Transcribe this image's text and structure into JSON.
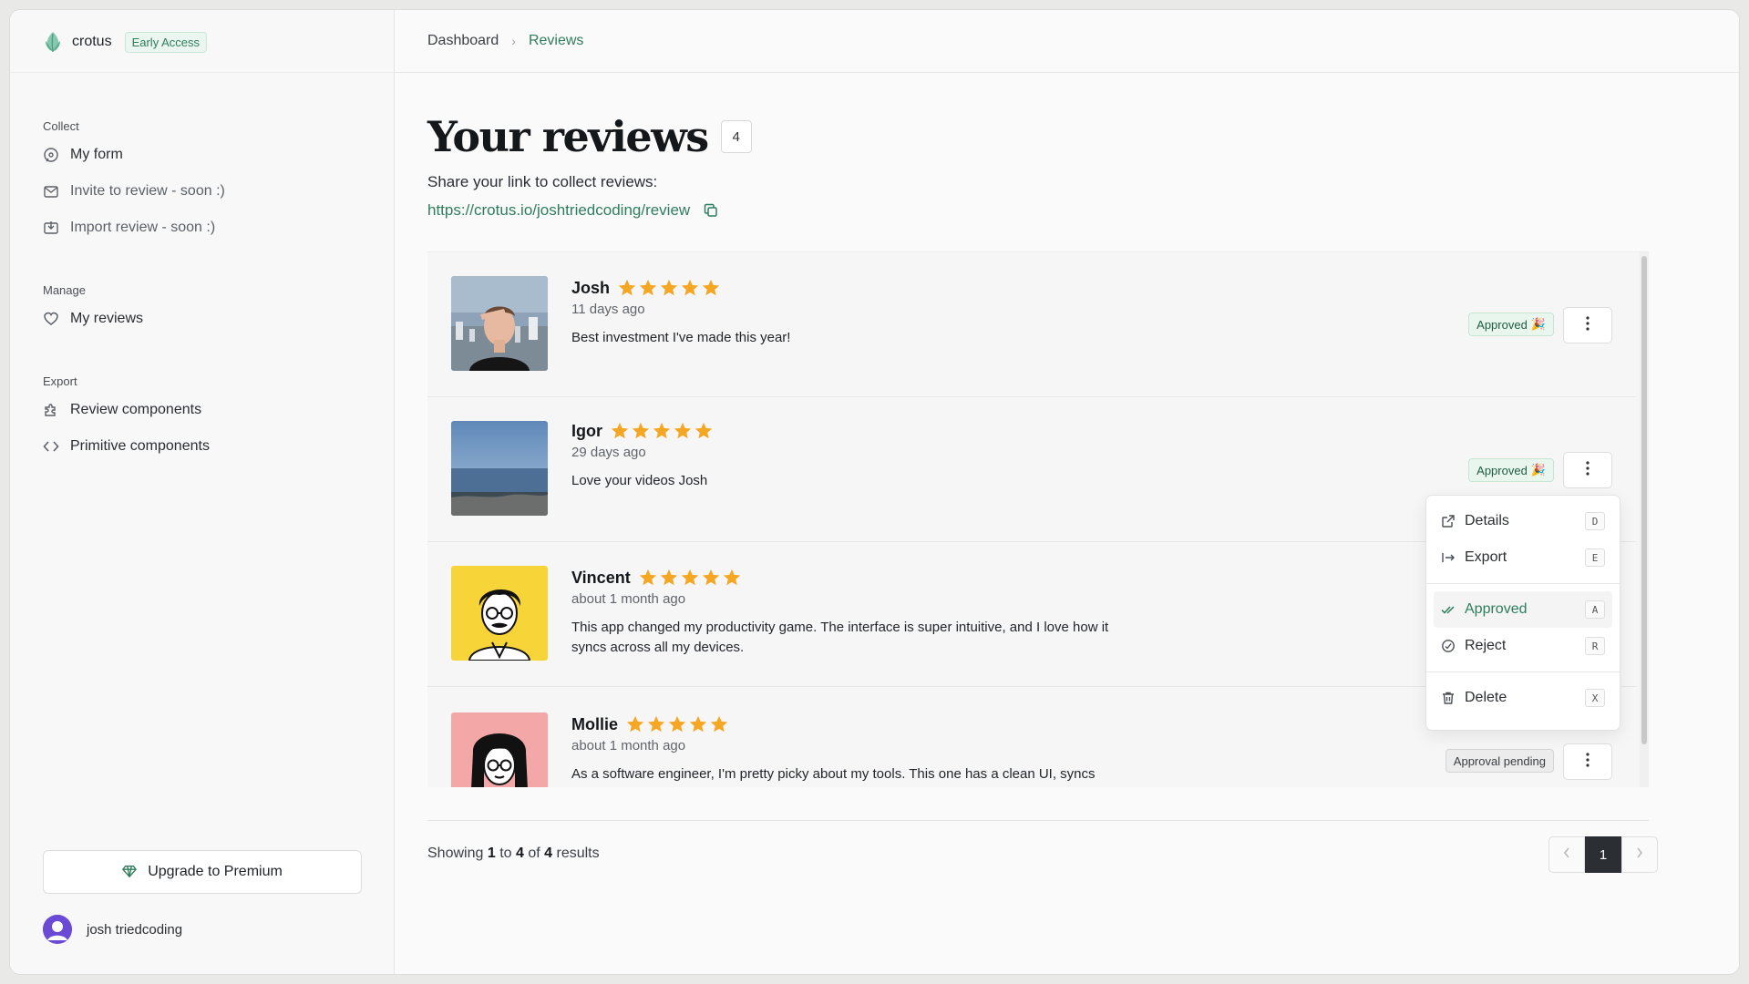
{
  "brand": {
    "name": "crotus",
    "badge": "Early Access",
    "accent": "#2f7d5d"
  },
  "sidebar": {
    "groups": [
      {
        "heading": "Collect",
        "items": [
          {
            "label": "My form",
            "icon": "chat-bubble-icon"
          },
          {
            "label": "Invite to review - soon :)",
            "icon": "mail-icon"
          },
          {
            "label": "Import review - soon :)",
            "icon": "import-icon"
          }
        ]
      },
      {
        "heading": "Manage",
        "items": [
          {
            "label": "My reviews",
            "icon": "heart-icon"
          }
        ]
      },
      {
        "heading": "Export",
        "items": [
          {
            "label": "Review components",
            "icon": "puzzle-icon"
          },
          {
            "label": "Primitive components",
            "icon": "code-icon"
          }
        ]
      }
    ],
    "upgrade_label": "Upgrade to Premium",
    "user_name": "josh triedcoding"
  },
  "breadcrumb": {
    "items": [
      "Dashboard",
      "Reviews"
    ],
    "separator": "›"
  },
  "page": {
    "title": "Your reviews",
    "count": "4",
    "share_text": "Share your link to collect reviews:",
    "share_link": "https://crotus.io/joshtriedcoding/review"
  },
  "reviews": [
    {
      "name": "Josh",
      "rating": 5,
      "time": "11 days ago",
      "text": "Best investment I've made this year!",
      "status": "Approved",
      "status_type": "approved"
    },
    {
      "name": "Igor",
      "rating": 5,
      "time": "29 days ago",
      "text": "Love your videos Josh",
      "status": "Approved",
      "status_type": "approved"
    },
    {
      "name": "Vincent",
      "rating": 5,
      "time": "about 1 month ago",
      "text": "This app changed my productivity game. The interface is super intuitive, and I love how it syncs across all my devices.",
      "status": "",
      "status_type": "hidden"
    },
    {
      "name": "Mollie",
      "rating": 5,
      "time": "about 1 month ago",
      "text": "As a software engineer, I'm pretty picky about my tools. This one has a clean UI, syncs",
      "status": "Approval pending",
      "status_type": "pending"
    }
  ],
  "menu": {
    "items": [
      {
        "label": "Details",
        "key": "D",
        "icon": "external-link-icon"
      },
      {
        "label": "Export",
        "key": "E",
        "icon": "export-arrow-icon"
      },
      {
        "label": "Approved",
        "key": "A",
        "icon": "double-check-icon",
        "selected": true
      },
      {
        "label": "Reject",
        "key": "R",
        "icon": "circle-slash-icon"
      },
      {
        "label": "Delete",
        "key": "X",
        "icon": "trash-icon"
      }
    ]
  },
  "pagination": {
    "prefix": "Showing",
    "from": "1",
    "to_word": "to",
    "to": "4",
    "of_word": "of",
    "total": "4",
    "suffix": "results",
    "current_page": "1"
  },
  "colors": {
    "star": "#f5a623",
    "approved_bg": "#e8f6ee",
    "pending_bg": "#ececec",
    "accent": "#2f7d5d"
  }
}
